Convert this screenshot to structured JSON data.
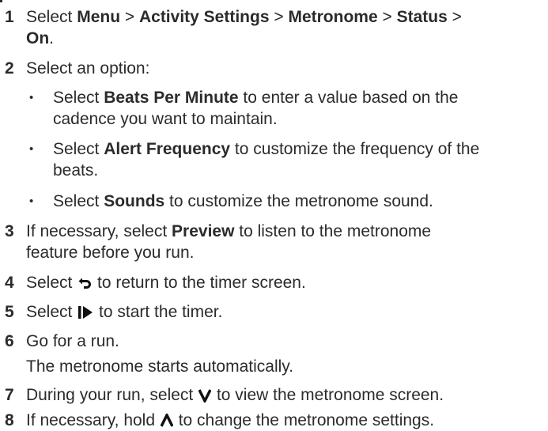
{
  "steps": [
    {
      "num": "1",
      "t1": "Select ",
      "b1": "Menu",
      "t2": " > ",
      "b2": "Activity Settings",
      "t3": " > ",
      "b3": "Metronome",
      "t4": " > ",
      "b4": "Status",
      "t5": " >",
      "b5": "On",
      "t6": "."
    },
    {
      "num": "2",
      "text": "Select an option:"
    },
    {
      "num": "3",
      "t1": "If necessary, select ",
      "b1": "Preview",
      "t2": " to listen to the metronome",
      "line2": "feature before you run."
    },
    {
      "num": "4",
      "t1": "Select ",
      "icon": "back-arrow-icon",
      "t2": " to return to the timer screen."
    },
    {
      "num": "5",
      "t1": "Select ",
      "icon": "play-pause-icon",
      "t2": " to start the timer."
    },
    {
      "num": "6",
      "text": "Go for a run.",
      "note": "The metronome starts automatically."
    },
    {
      "num": "7",
      "t1": "During your run, select ",
      "icon": "down-arrow-icon",
      "t2": " to view the metronome screen."
    },
    {
      "num": "8",
      "t1": "If necessary, hold ",
      "icon": "up-arrow-icon",
      "t2": " to change the metronome settings."
    }
  ],
  "options": [
    {
      "bullet": "•",
      "t1": "Select ",
      "b1": "Beats Per Minute",
      "t2": " to enter a value based on the",
      "line2": "cadence you want to maintain."
    },
    {
      "bullet": "•",
      "t1": "Select ",
      "b1": "Alert Frequency",
      "t2": " to customize the frequency of the",
      "line2": "beats."
    },
    {
      "bullet": "•",
      "t1": "Select ",
      "b1": "Sounds",
      "t2": " to customize the metronome sound."
    }
  ],
  "colors": {
    "text": "#2b2b2b"
  }
}
